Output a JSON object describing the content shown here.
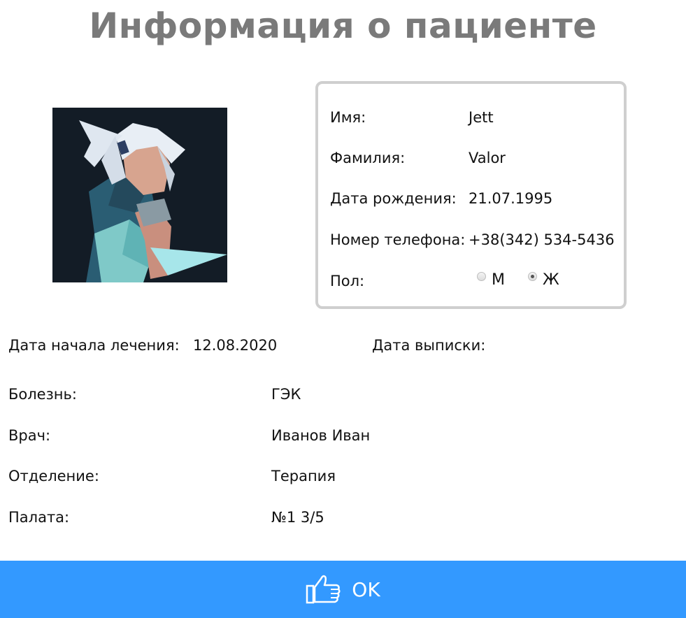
{
  "header": {
    "title": "Информация о пациенте"
  },
  "photo": {
    "description": "patient-avatar"
  },
  "patient": {
    "first_name_label": "Имя:",
    "first_name": "Jett",
    "last_name_label": "Фамилия:",
    "last_name": "Valor",
    "birth_label": "Дата рождения:",
    "birth_date": "21.07.1995",
    "phone_label": "Номер телефона:",
    "phone": "+38(342) 534-5436",
    "gender_label": "Пол:",
    "gender_options": [
      "М",
      "Ж"
    ],
    "gender_selected": "Ж"
  },
  "treatment": {
    "start_label": "Дата начала лечения:",
    "start_date": "12.08.2020",
    "discharge_label": "Дата выписки:",
    "discharge_date": "",
    "disease_label": "Болезнь:",
    "disease": "ГЭК",
    "doctor_label": "Врач:",
    "doctor": "Иванов Иван",
    "department_label": "Отделение:",
    "department": "Терапия",
    "ward_label": "Палата:",
    "ward": "№1 3/5"
  },
  "footer": {
    "ok_label": "OK",
    "ok_icon": "thumbs-up-icon"
  },
  "colors": {
    "accent": "#3399ff",
    "title": "#7a7a7a",
    "card_border": "#cfcfcf"
  }
}
